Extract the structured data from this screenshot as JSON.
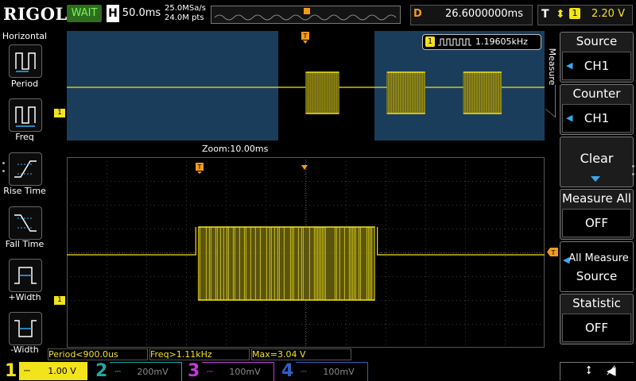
{
  "topbar": {
    "logo": "RIGOL",
    "run_status": "WAIT",
    "h_label": "H",
    "timebase": "50.0ms",
    "sample_rate": "25.0MSa/s",
    "mem_depth": "24.0M pts",
    "delay_label": "D",
    "delay_value": "26.6000000ms",
    "trigger_label": "T",
    "trigger_edge_symbol": "⬍",
    "trigger_channel": "1",
    "trigger_level": "2.20 V"
  },
  "left_menu": {
    "title": "Horizontal",
    "items": [
      {
        "label": "Period",
        "icon": "period-icon"
      },
      {
        "label": "Freq",
        "icon": "frequency-icon"
      },
      {
        "label": "Rise Time",
        "icon": "rise-time-icon"
      },
      {
        "label": "Fall Time",
        "icon": "fall-time-icon"
      },
      {
        "label": "+Width",
        "icon": "positive-width-icon"
      },
      {
        "label": "-Width",
        "icon": "negative-width-icon"
      }
    ]
  },
  "overview": {
    "freq_badge_channel": "1",
    "freq_value": "1.19605kHz",
    "zoom_label": "Zoom:10.00ms",
    "ch1_marker": "1",
    "bursts": [
      {
        "start": 0.5,
        "end": 0.57
      },
      {
        "start": 0.67,
        "end": 0.75
      },
      {
        "start": 0.83,
        "end": 0.91
      }
    ]
  },
  "main_view": {
    "ch1_marker": "1",
    "burst": {
      "start": 0.27,
      "end": 0.65
    }
  },
  "status_bar": {
    "period": "Period<900.0us",
    "freq": "Freq>1.11kHz",
    "max": "Max=3.04 V"
  },
  "channels": [
    {
      "num": "1",
      "scale": "1.00 V",
      "color": "#f2e31b",
      "active": true
    },
    {
      "num": "2",
      "scale": "200mV",
      "color": "#1fa9a3",
      "active": false
    },
    {
      "num": "3",
      "scale": "100mV",
      "color": "#c33ad6",
      "active": false
    },
    {
      "num": "4",
      "scale": "100mV",
      "color": "#2f5fc4",
      "active": false
    }
  ],
  "right_menu": {
    "title": "Measure",
    "items": [
      {
        "label": "Source",
        "value": "CH1"
      },
      {
        "label": "Counter",
        "value": "CH1"
      },
      {
        "label": "Clear",
        "value": ""
      },
      {
        "label": "Measure All",
        "value": "OFF"
      },
      {
        "label": "All Measure",
        "label2": "Source",
        "value": ""
      },
      {
        "label": "Statistic",
        "value": "OFF"
      }
    ]
  },
  "colors": {
    "ch1": "#f2e31b",
    "trigger": "#f39a1d",
    "overview_bg": "#1a3d5c"
  }
}
